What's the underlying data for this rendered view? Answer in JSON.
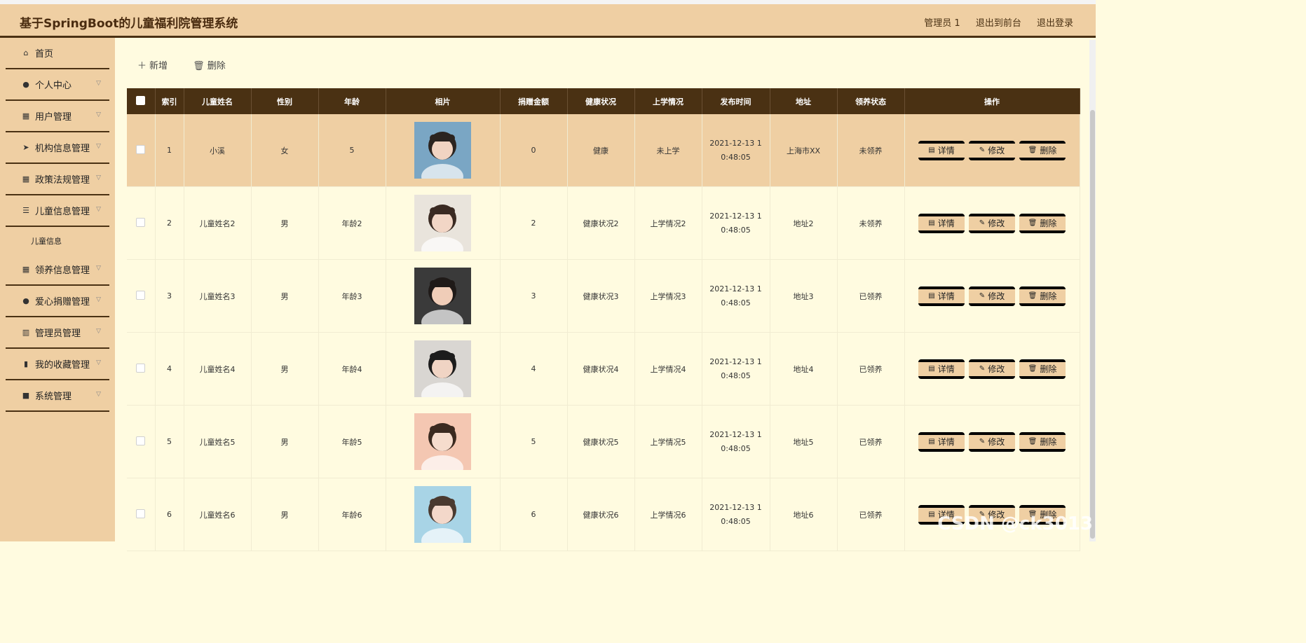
{
  "app": {
    "title": "基于SpringBoot的儿童福利院管理系统"
  },
  "header": {
    "user": "管理员 1",
    "to_front": "退出到前台",
    "logout": "退出登录"
  },
  "sidebar": {
    "items": [
      {
        "label": "首页",
        "icon": "home-icon",
        "glyph": "⌂",
        "chevron": false
      },
      {
        "label": "个人中心",
        "icon": "user-icon",
        "glyph": "●",
        "chevron": true
      },
      {
        "label": "用户管理",
        "icon": "grid-icon",
        "glyph": "▦",
        "chevron": true
      },
      {
        "label": "机构信息管理",
        "icon": "send-icon",
        "glyph": "➤",
        "chevron": true
      },
      {
        "label": "政策法规管理",
        "icon": "grid-icon",
        "glyph": "▦",
        "chevron": true
      },
      {
        "label": "儿童信息管理",
        "icon": "list-icon",
        "glyph": "☰",
        "chevron": true,
        "sub": [
          "儿童信息"
        ]
      },
      {
        "label": "领养信息管理",
        "icon": "grid-icon",
        "glyph": "▦",
        "chevron": true
      },
      {
        "label": "爱心捐赠管理",
        "icon": "user-icon",
        "glyph": "●",
        "chevron": true
      },
      {
        "label": "管理员管理",
        "icon": "books-icon",
        "glyph": "▥",
        "chevron": true
      },
      {
        "label": "我的收藏管理",
        "icon": "bar-chart-icon",
        "glyph": "▮",
        "chevron": true
      },
      {
        "label": "系统管理",
        "icon": "clipboard-icon",
        "glyph": "■",
        "chevron": true
      }
    ]
  },
  "toolbar": {
    "add": "新增",
    "delete": "删除"
  },
  "table": {
    "headers": [
      "索引",
      "儿童姓名",
      "性别",
      "年龄",
      "相片",
      "捐赠金额",
      "健康状况",
      "上学情况",
      "发布时间",
      "地址",
      "领养状态",
      "操作"
    ],
    "rows": [
      {
        "idx": "1",
        "name": "小溪",
        "sex": "女",
        "age": "5",
        "money": "0",
        "health": "健康",
        "school": "未上学",
        "time1": "2021-12-13 1",
        "time2": "0:48:05",
        "addr": "上海市XX",
        "status": "未领养",
        "photo": {
          "bg": "#7aa6c4",
          "face": "#f1d4c2",
          "hair": "#2b2420"
        }
      },
      {
        "idx": "2",
        "name": "儿童姓名2",
        "sex": "男",
        "age": "年龄2",
        "money": "2",
        "health": "健康状况2",
        "school": "上学情况2",
        "time1": "2021-12-13 1",
        "time2": "0:48:05",
        "addr": "地址2",
        "status": "未领养",
        "photo": {
          "bg": "#e9e4dc",
          "face": "#f2d6c6",
          "hair": "#3a2a22"
        }
      },
      {
        "idx": "3",
        "name": "儿童姓名3",
        "sex": "男",
        "age": "年龄3",
        "money": "3",
        "health": "健康状况3",
        "school": "上学情况3",
        "time1": "2021-12-13 1",
        "time2": "0:48:05",
        "addr": "地址3",
        "status": "已领养",
        "photo": {
          "bg": "#3a3a3a",
          "face": "#f0cdb8",
          "hair": "#1f1a18"
        }
      },
      {
        "idx": "4",
        "name": "儿童姓名4",
        "sex": "男",
        "age": "年龄4",
        "money": "4",
        "health": "健康状况4",
        "school": "上学情况4",
        "time1": "2021-12-13 1",
        "time2": "0:48:05",
        "addr": "地址4",
        "status": "已领养",
        "photo": {
          "bg": "#d9d6d2",
          "face": "#f0d4c4",
          "hair": "#1c1c1c"
        }
      },
      {
        "idx": "5",
        "name": "儿童姓名5",
        "sex": "男",
        "age": "年龄5",
        "money": "5",
        "health": "健康状况5",
        "school": "上学情况5",
        "time1": "2021-12-13 1",
        "time2": "0:48:05",
        "addr": "地址5",
        "status": "已领养",
        "photo": {
          "bg": "#f4c7b2",
          "face": "#f6dccd",
          "hair": "#3b2a20"
        }
      },
      {
        "idx": "6",
        "name": "儿童姓名6",
        "sex": "男",
        "age": "年龄6",
        "money": "6",
        "health": "健康状况6",
        "school": "上学情况6",
        "time1": "2021-12-13 1",
        "time2": "0:48:05",
        "addr": "地址6",
        "status": "已领养",
        "photo": {
          "bg": "#a8d4e6",
          "face": "#f3d8ca",
          "hair": "#4a3a30"
        }
      }
    ],
    "actions": {
      "detail": "详情",
      "edit": "修改",
      "delete": "删除"
    }
  },
  "watermark": "CSDN @ck3013",
  "colors": {
    "header_bg": "#efcfa3",
    "table_header": "#4a3113",
    "page_bg": "#fffbe0"
  }
}
